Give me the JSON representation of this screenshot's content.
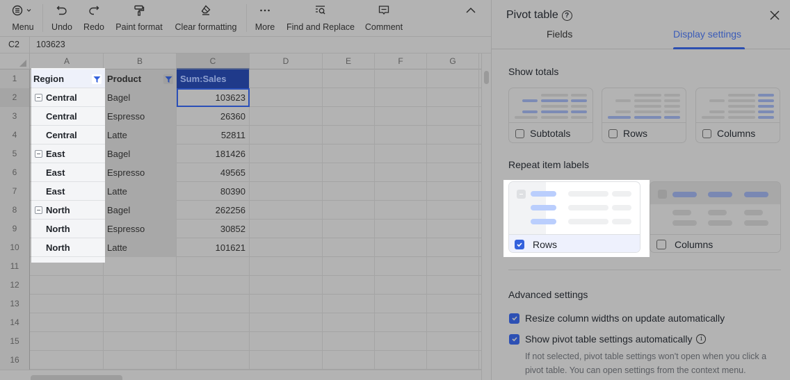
{
  "toolbar": {
    "menu": "Menu",
    "undo": "Undo",
    "redo": "Redo",
    "paint_format": "Paint format",
    "clear_formatting": "Clear formatting",
    "more": "More",
    "find_replace": "Find and Replace",
    "comment": "Comment"
  },
  "formula_bar": {
    "cell_ref": "C2",
    "value": "103623"
  },
  "grid": {
    "columns": [
      "A",
      "B",
      "C",
      "D",
      "E",
      "F",
      "G"
    ],
    "selected_column": "C",
    "row_numbers": [
      "1",
      "2",
      "3",
      "4",
      "5",
      "6",
      "7",
      "8",
      "9",
      "10",
      "11",
      "12",
      "13",
      "14",
      "15",
      "16"
    ],
    "selected_row": "2",
    "header": {
      "region": "Region",
      "product": "Product",
      "sum_sales": "Sum:Sales"
    },
    "rows": [
      {
        "region": "Central",
        "group_start": true,
        "product": "Bagel",
        "sales": "103623"
      },
      {
        "region": "Central",
        "group_start": false,
        "product": "Espresso",
        "sales": "26360"
      },
      {
        "region": "Central",
        "group_start": false,
        "product": "Latte",
        "sales": "52811"
      },
      {
        "region": "East",
        "group_start": true,
        "product": "Bagel",
        "sales": "181426"
      },
      {
        "region": "East",
        "group_start": false,
        "product": "Espresso",
        "sales": "49565"
      },
      {
        "region": "East",
        "group_start": false,
        "product": "Latte",
        "sales": "80390"
      },
      {
        "region": "North",
        "group_start": true,
        "product": "Bagel",
        "sales": "262256"
      },
      {
        "region": "North",
        "group_start": false,
        "product": "Espresso",
        "sales": "30852"
      },
      {
        "region": "North",
        "group_start": false,
        "product": "Latte",
        "sales": "101621"
      }
    ],
    "selected_cell": "C2"
  },
  "panel": {
    "title": "Pivot table",
    "tabs": [
      {
        "label": "Fields",
        "active": false
      },
      {
        "label": "Display settings",
        "active": true
      }
    ],
    "show_totals": {
      "title": "Show totals",
      "options": [
        {
          "label": "Subtotals",
          "checked": false
        },
        {
          "label": "Rows",
          "checked": false
        },
        {
          "label": "Columns",
          "checked": false
        }
      ]
    },
    "repeat_labels": {
      "title": "Repeat item labels",
      "options": [
        {
          "label": "Rows",
          "checked": true
        },
        {
          "label": "Columns",
          "checked": false
        }
      ]
    },
    "advanced": {
      "title": "Advanced settings",
      "options": [
        {
          "label": "Resize column widths on update automatically",
          "checked": true
        },
        {
          "label": "Show pivot table settings automatically",
          "checked": true
        }
      ],
      "help_text": "If not selected, pivot table settings won't open when you click a pivot table. You can open settings from the context menu."
    }
  },
  "colors": {
    "accent": "#3462dd",
    "sum_header_bg": "#1f3a8a",
    "tab_active": "#3a5bb8"
  }
}
